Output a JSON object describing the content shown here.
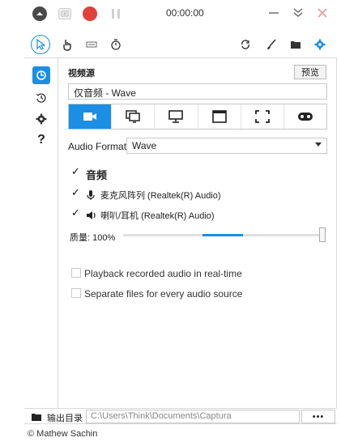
{
  "titlebar": {
    "timer": "00:00:00",
    "colors": {
      "record": "#e0413b",
      "accent": "#1a8fe3"
    }
  },
  "toolbar": {
    "tools": [
      "cursor-icon",
      "hand-icon",
      "keyboard-icon",
      "stopwatch-icon"
    ],
    "right_tools": [
      "refresh-icon",
      "brush-icon",
      "folder-icon",
      "gear-icon"
    ]
  },
  "sidebar": {
    "items": [
      "home-icon",
      "history-icon",
      "settings-icon",
      "help-icon"
    ],
    "help_glyph": "?"
  },
  "main": {
    "source_label": "视频源",
    "preview_label": "预览",
    "source_value": "仅音频 - Wave",
    "modes": [
      "camera-icon",
      "screen-icon",
      "monitor-icon",
      "window-icon",
      "region-icon",
      "game-icon"
    ],
    "active_mode": 0,
    "audio_format_label": "Audio Format",
    "audio_format_value": "Wave",
    "audio_title": "音频",
    "devices": [
      {
        "label": "麦克风阵列 (Realtek(R) Audio)",
        "checked": true,
        "icon": "microphone-icon"
      },
      {
        "label": "喇叭/耳机 (Realtek(R) Audio)",
        "checked": true,
        "icon": "speaker-icon"
      }
    ],
    "quality_label": "质量: 100%",
    "options": [
      {
        "label": "Playback recorded audio in real-time",
        "checked": false
      },
      {
        "label": "Separate files for every audio source",
        "checked": false
      }
    ]
  },
  "bottom": {
    "output_label": "输出目录",
    "output_path": "C:\\Users\\Think\\Documents\\Captura",
    "more_label": "•••"
  },
  "credit": "© Mathew Sachin"
}
